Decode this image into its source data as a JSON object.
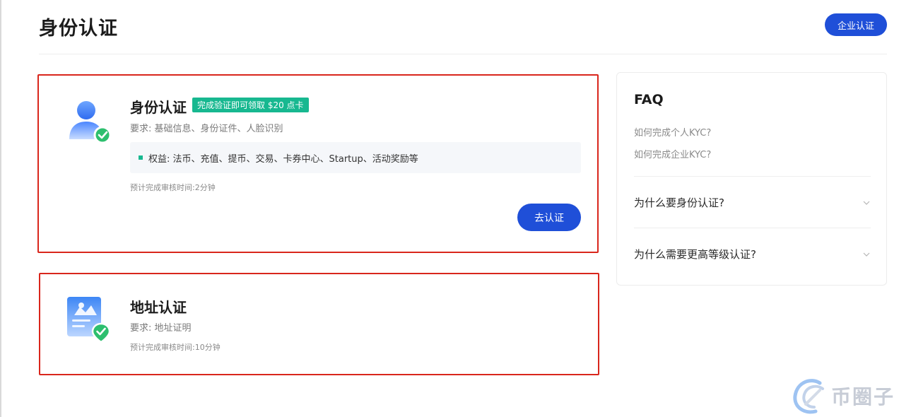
{
  "header": {
    "title": "身份认证",
    "enterprise_button": "企业认证"
  },
  "identity_card": {
    "title": "身份认证",
    "badge": "完成验证即可领取 $20 点卡",
    "requirements": "要求: 基础信息、身份证件、人脸识别",
    "benefits": "权益: 法币、充值、提币、交易、卡券中心、Startup、活动奖励等",
    "estimated_time": "预计完成审核时间:2分钟",
    "action_button": "去认证",
    "icon": "user-verified-icon"
  },
  "address_card": {
    "title": "地址认证",
    "requirements": "要求: 地址证明",
    "estimated_time": "预计完成审核时间:10分钟",
    "icon": "address-document-verified-icon"
  },
  "faq": {
    "title": "FAQ",
    "links": [
      "如何完成个人KYC?",
      "如何完成企业KYC?"
    ],
    "questions": [
      "为什么要身份认证?",
      "为什么需要更高等级认证?"
    ]
  },
  "watermark": {
    "text": "币圈子"
  },
  "colors": {
    "primary": "#1f4fd8",
    "accent_green": "#17b890",
    "highlight_red": "#d9261c"
  }
}
